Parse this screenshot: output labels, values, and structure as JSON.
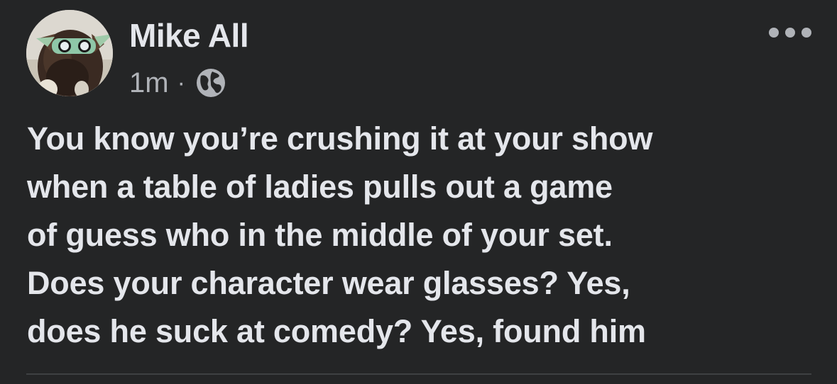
{
  "post": {
    "author": "Mike All",
    "time": "1m",
    "separator": "·",
    "audience_icon": "globe-icon",
    "more_icon": "more-options-icon",
    "text_lines": [
      "You know you’re crushing it at your show",
      "when a table of ladies pulls out a game",
      "of guess who in the middle of your set.",
      "Does your character wear glasses? Yes,",
      "does he suck at comedy? Yes, found him"
    ]
  },
  "colors": {
    "background": "#242526",
    "primary_text": "#e4e6eb",
    "secondary_text": "#b0b3b8",
    "divider": "#3e4042"
  }
}
